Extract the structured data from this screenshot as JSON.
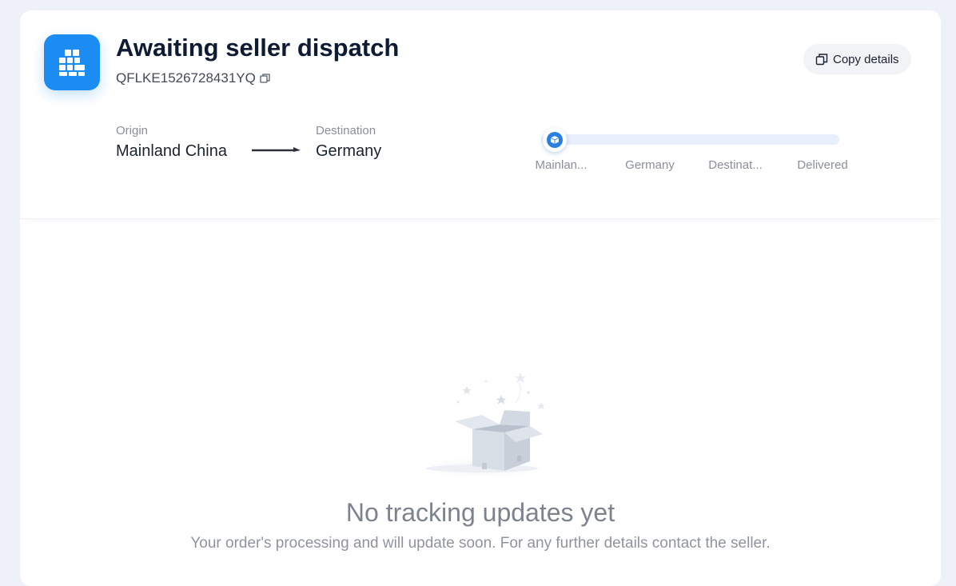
{
  "order": {
    "status_title": "Awaiting seller dispatch",
    "tracking_number": "QFLKE1526728431YQ",
    "copy_details_label": "Copy details"
  },
  "route": {
    "origin_label": "Origin",
    "origin_value": "Mainland China",
    "destination_label": "Destination",
    "destination_value": "Germany"
  },
  "progress": {
    "stages": [
      "Mainlan...",
      "Germany",
      "Destinat...",
      "Delivered"
    ],
    "current_stage_index": 0,
    "fraction": 0.0
  },
  "empty_state": {
    "title": "No tracking updates yet",
    "message": "Your order's processing and will update soon. For any further details contact the seller."
  },
  "colors": {
    "accent": "#1a8cf2",
    "track": "#e7f0fb",
    "background": "#eef1f8"
  },
  "icons": {
    "app": "grid-icon",
    "copy": "copy-icon",
    "arrow": "arrow-right-icon",
    "progress_marker": "package-icon",
    "empty": "empty-box-icon"
  }
}
